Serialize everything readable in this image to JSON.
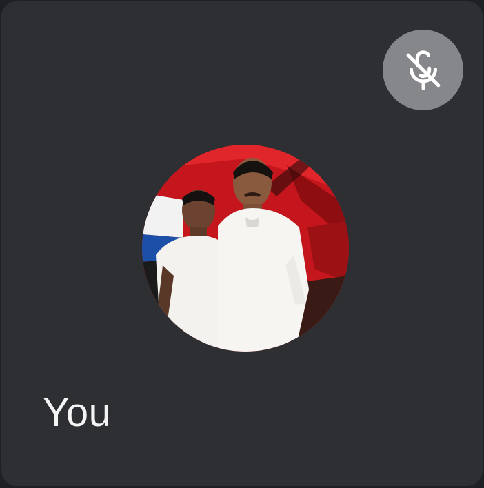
{
  "participant": {
    "name": "You",
    "muted": true
  },
  "icons": {
    "mute_status": "mic-off-icon"
  },
  "colors": {
    "tile_background": "#2e2f33",
    "mute_badge": "#86878a",
    "name_text": "#f4f4f4"
  }
}
